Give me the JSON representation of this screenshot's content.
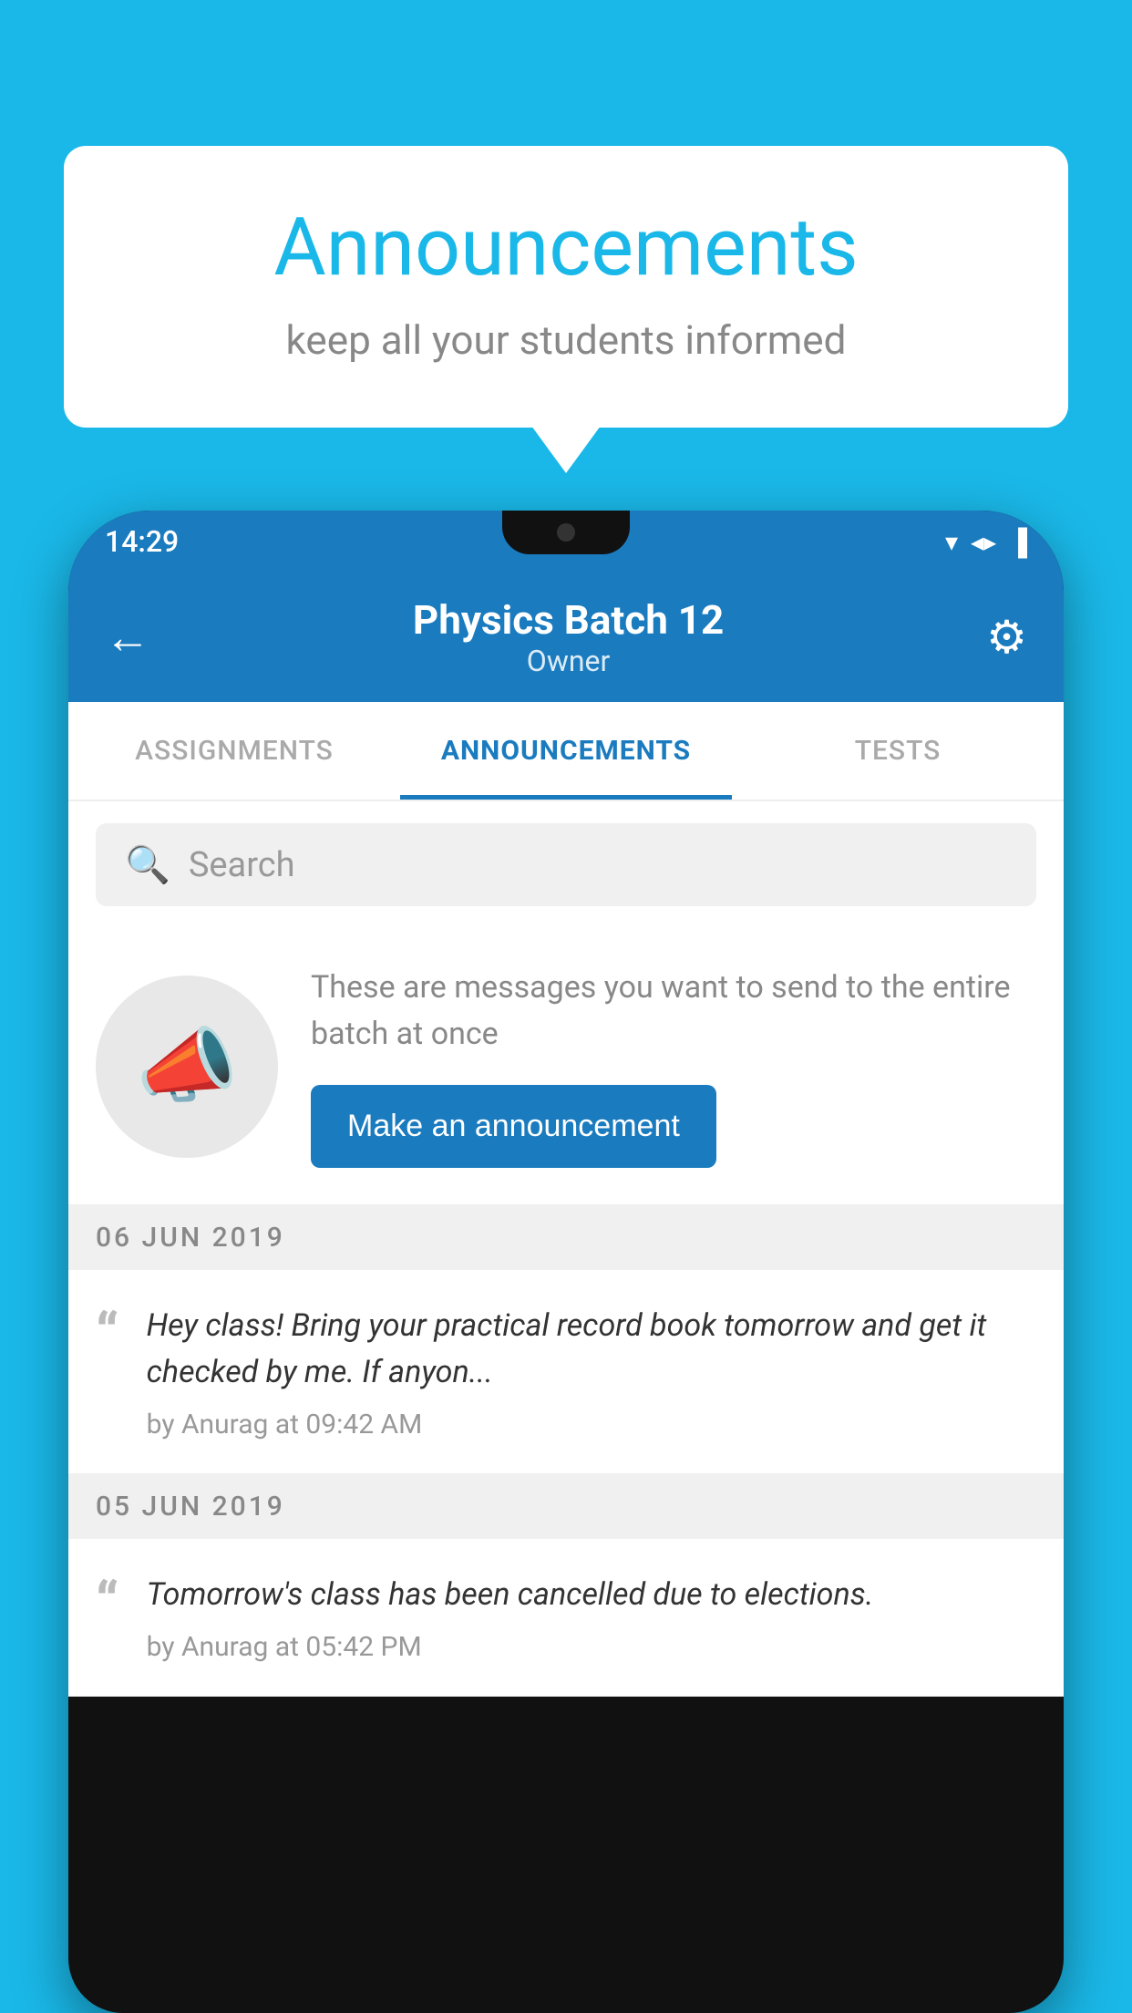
{
  "background_color": "#1ab8e8",
  "bubble": {
    "title": "Announcements",
    "subtitle": "keep all your students informed"
  },
  "phone": {
    "status_bar": {
      "time": "14:29",
      "icons": [
        "▼",
        "◀",
        "▐"
      ]
    },
    "header": {
      "back_label": "←",
      "title": "Physics Batch 12",
      "subtitle": "Owner",
      "gear_label": "⚙"
    },
    "tabs": [
      {
        "label": "ASSIGNMENTS",
        "active": false
      },
      {
        "label": "ANNOUNCEMENTS",
        "active": true
      },
      {
        "label": "TESTS",
        "active": false
      },
      {
        "label": "...",
        "active": false
      }
    ],
    "search": {
      "placeholder": "Search"
    },
    "announcement_prompt": {
      "description": "These are messages you want to send to the entire batch at once",
      "button_label": "Make an announcement"
    },
    "announcements": [
      {
        "date": "06  JUN  2019",
        "text": "Hey class! Bring your practical record book tomorrow and get it checked by me. If anyon...",
        "meta": "by Anurag at 09:42 AM"
      },
      {
        "date": "05  JUN  2019",
        "text": "Tomorrow's class has been cancelled due to elections.",
        "meta": "by Anurag at 05:42 PM"
      }
    ]
  }
}
